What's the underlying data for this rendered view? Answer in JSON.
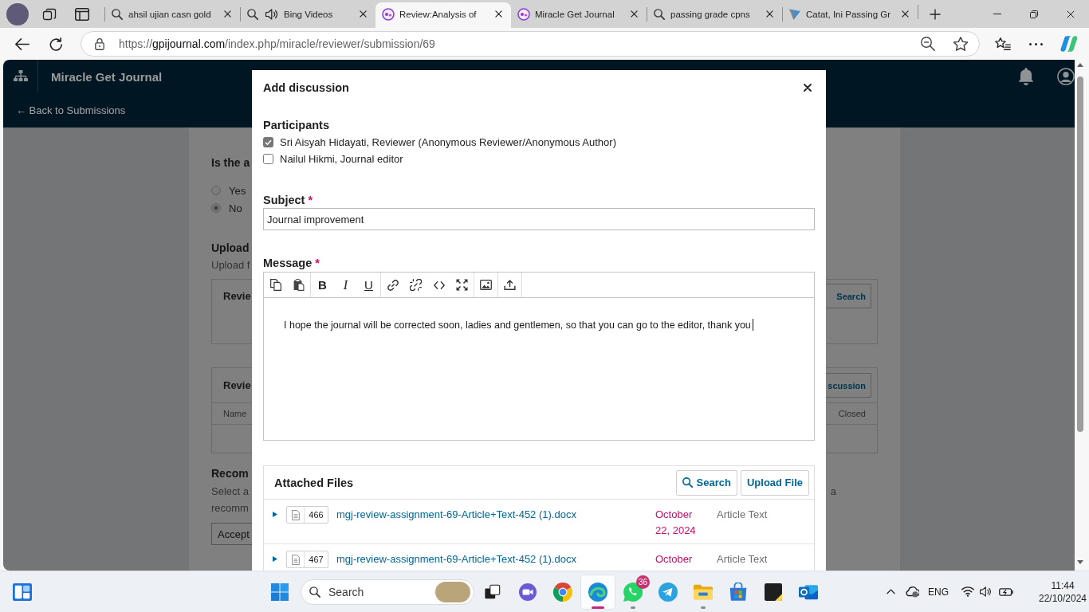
{
  "browser": {
    "tabs": [
      {
        "title": "ahsil ujian casn gold",
        "kind": "search",
        "audio": false,
        "selected": false
      },
      {
        "title": "Bing Videos",
        "kind": "search",
        "audio": true,
        "selected": false
      },
      {
        "title": "Review:Analysis of",
        "kind": "journal",
        "audio": false,
        "selected": true
      },
      {
        "title": "Miracle Get Journal",
        "kind": "journal",
        "audio": false,
        "selected": false
      },
      {
        "title": "passing grade cpns",
        "kind": "search",
        "audio": false,
        "selected": false
      },
      {
        "title": "Catat, Ini Passing Gr",
        "kind": "news",
        "audio": false,
        "selected": false
      }
    ],
    "address": {
      "scheme": "https://",
      "host": "gpijournal.com",
      "path": "/index.php/miracle/reviewer/submission/69"
    }
  },
  "site_header": {
    "title": "Miracle Get Journal",
    "back_link": "← Back to Submissions"
  },
  "review_page": {
    "question": "Is the a",
    "options": [
      {
        "label": "Yes",
        "selected": false
      },
      {
        "label": "No",
        "selected": true
      }
    ],
    "upload_heading": "Upload",
    "upload_text": "Upload f",
    "files_panel": {
      "title": "Revie",
      "button": "Search"
    },
    "discussions_panel": {
      "title": "Revie",
      "button": "scussion",
      "columns": [
        "Name",
        "Closed"
      ]
    },
    "recommendation_heading": "Recom",
    "recommendation_text": {
      "line_1_start": "Select a",
      "line_1_end": "a",
      "line_2_start": "recomm"
    },
    "recommendation_select": "Accept"
  },
  "dialog": {
    "title": "Add discussion",
    "participants_label": "Participants",
    "participants": [
      {
        "label": "Sri Aisyah Hidayati, Reviewer (Anonymous Reviewer/Anonymous Author)",
        "checked": true
      },
      {
        "label": "Nailul Hikmi, Journal editor",
        "checked": false
      }
    ],
    "subject": {
      "label": "Subject",
      "required_mark": "*",
      "value": "Journal improvement"
    },
    "message": {
      "label": "Message",
      "required_mark": "*",
      "toolbar": [
        {
          "items": [
            {
              "kind": "copy"
            },
            {
              "kind": "paste"
            }
          ]
        },
        {
          "items": [
            {
              "kind": "bold",
              "glyph": "B"
            },
            {
              "kind": "italic",
              "glyph": "I"
            },
            {
              "kind": "underline",
              "glyph": "U"
            }
          ]
        },
        {
          "items": [
            {
              "kind": "link"
            },
            {
              "kind": "unlink"
            },
            {
              "kind": "code"
            },
            {
              "kind": "fullscreen"
            }
          ]
        },
        {
          "items": [
            {
              "kind": "image"
            }
          ]
        },
        {
          "items": [
            {
              "kind": "upload"
            }
          ]
        }
      ],
      "value": "I hope the journal will be corrected soon, ladies and gentlemen, so that you can go to the editor, thank you",
      "focused": true
    },
    "attached_files": {
      "title": "Attached Files",
      "buttons": [
        {
          "label": "Search",
          "kind": "search"
        },
        {
          "label": "Upload File",
          "kind": "plain"
        }
      ],
      "rows": [
        {
          "expanded": false,
          "file_id": "466",
          "name": "mgj-review-assignment-69-Article+Text-452 (1).docx",
          "date": "October 22, 2024",
          "type": "Article Text"
        },
        {
          "expanded": false,
          "file_id": "467",
          "name": "mgj-review-assignment-69-Article+Text-452 (1).docx",
          "date": "October",
          "type": "Article Text"
        }
      ]
    }
  },
  "taskbar": {
    "search": {
      "placeholder": "Search"
    },
    "apps": [
      {
        "kind": "squares",
        "running": false,
        "selected": false
      },
      {
        "kind": "videochat",
        "running": false,
        "selected": false
      },
      {
        "kind": "browser",
        "running": false,
        "selected": false
      },
      {
        "kind": "wave",
        "running": true,
        "selected": true
      },
      {
        "kind": "phonechat",
        "running": true,
        "selected": false,
        "badge": "36"
      },
      {
        "kind": "plane",
        "running": false,
        "selected": false
      },
      {
        "kind": "folder",
        "running": true,
        "selected": false
      },
      {
        "kind": "bag",
        "running": false,
        "selected": false
      },
      {
        "kind": "note",
        "running": false,
        "selected": false
      },
      {
        "kind": "mail",
        "running": false,
        "selected": false
      }
    ],
    "language": "ENG",
    "time": "11:44",
    "date": "22/10/2024"
  }
}
